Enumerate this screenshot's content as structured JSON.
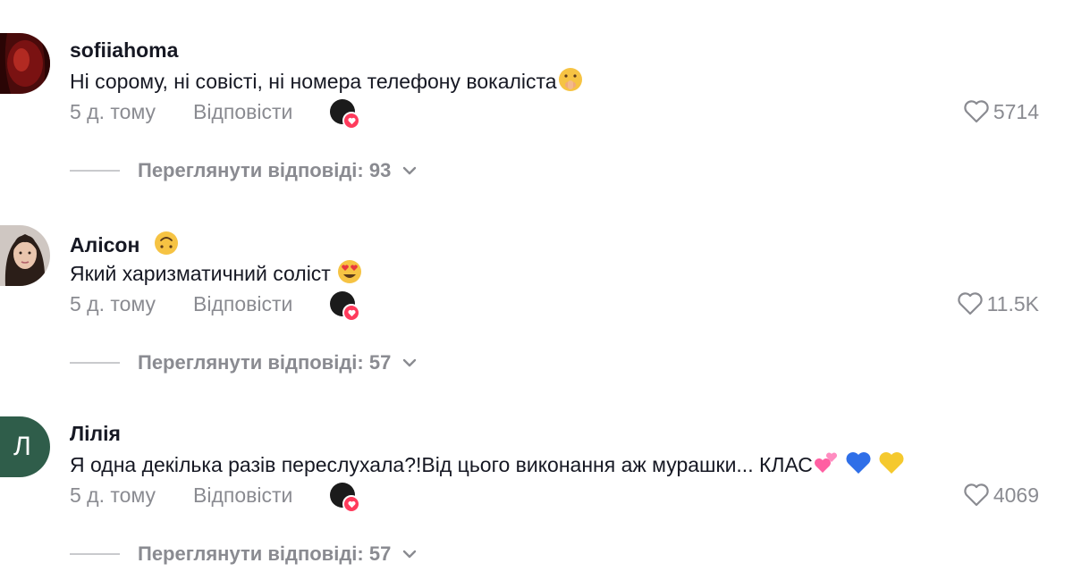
{
  "comments": [
    {
      "username": "sofiiahoma",
      "text": "Ні сорому, ні совісті, ні номера телефону вокаліста",
      "text_emoji": "shushing-face-emoji",
      "time": "5 д. тому",
      "reply_label": "Відповісти",
      "likes": "5714",
      "replies_label": "Переглянути відповіді: 93"
    },
    {
      "username": "Алісон",
      "username_emoji": "upside-down-face-emoji",
      "text": "Який харизматичний соліст",
      "text_emoji": "heart-eyes-emoji",
      "time": "5 д. тому",
      "reply_label": "Відповісти",
      "likes": "11.5K",
      "replies_label": "Переглянути відповіді: 57"
    },
    {
      "username": "Лілія",
      "avatar_letter": "Л",
      "text": "Я одна декілька разів переслухала?!Від цього виконання аж мурашки... КЛАС",
      "text_emoji": [
        "two-hearts-emoji",
        "blue-heart-emoji",
        "yellow-heart-emoji"
      ],
      "time": "5 д. тому",
      "reply_label": "Відповісти",
      "likes": "4069",
      "replies_label": "Переглянути відповіді: 57"
    }
  ],
  "colors": {
    "text": "#161823",
    "secondary": "#8a8b91",
    "creator_heart": "#ff3b5c",
    "avatar_letter_bg": "#2f5d4a"
  }
}
